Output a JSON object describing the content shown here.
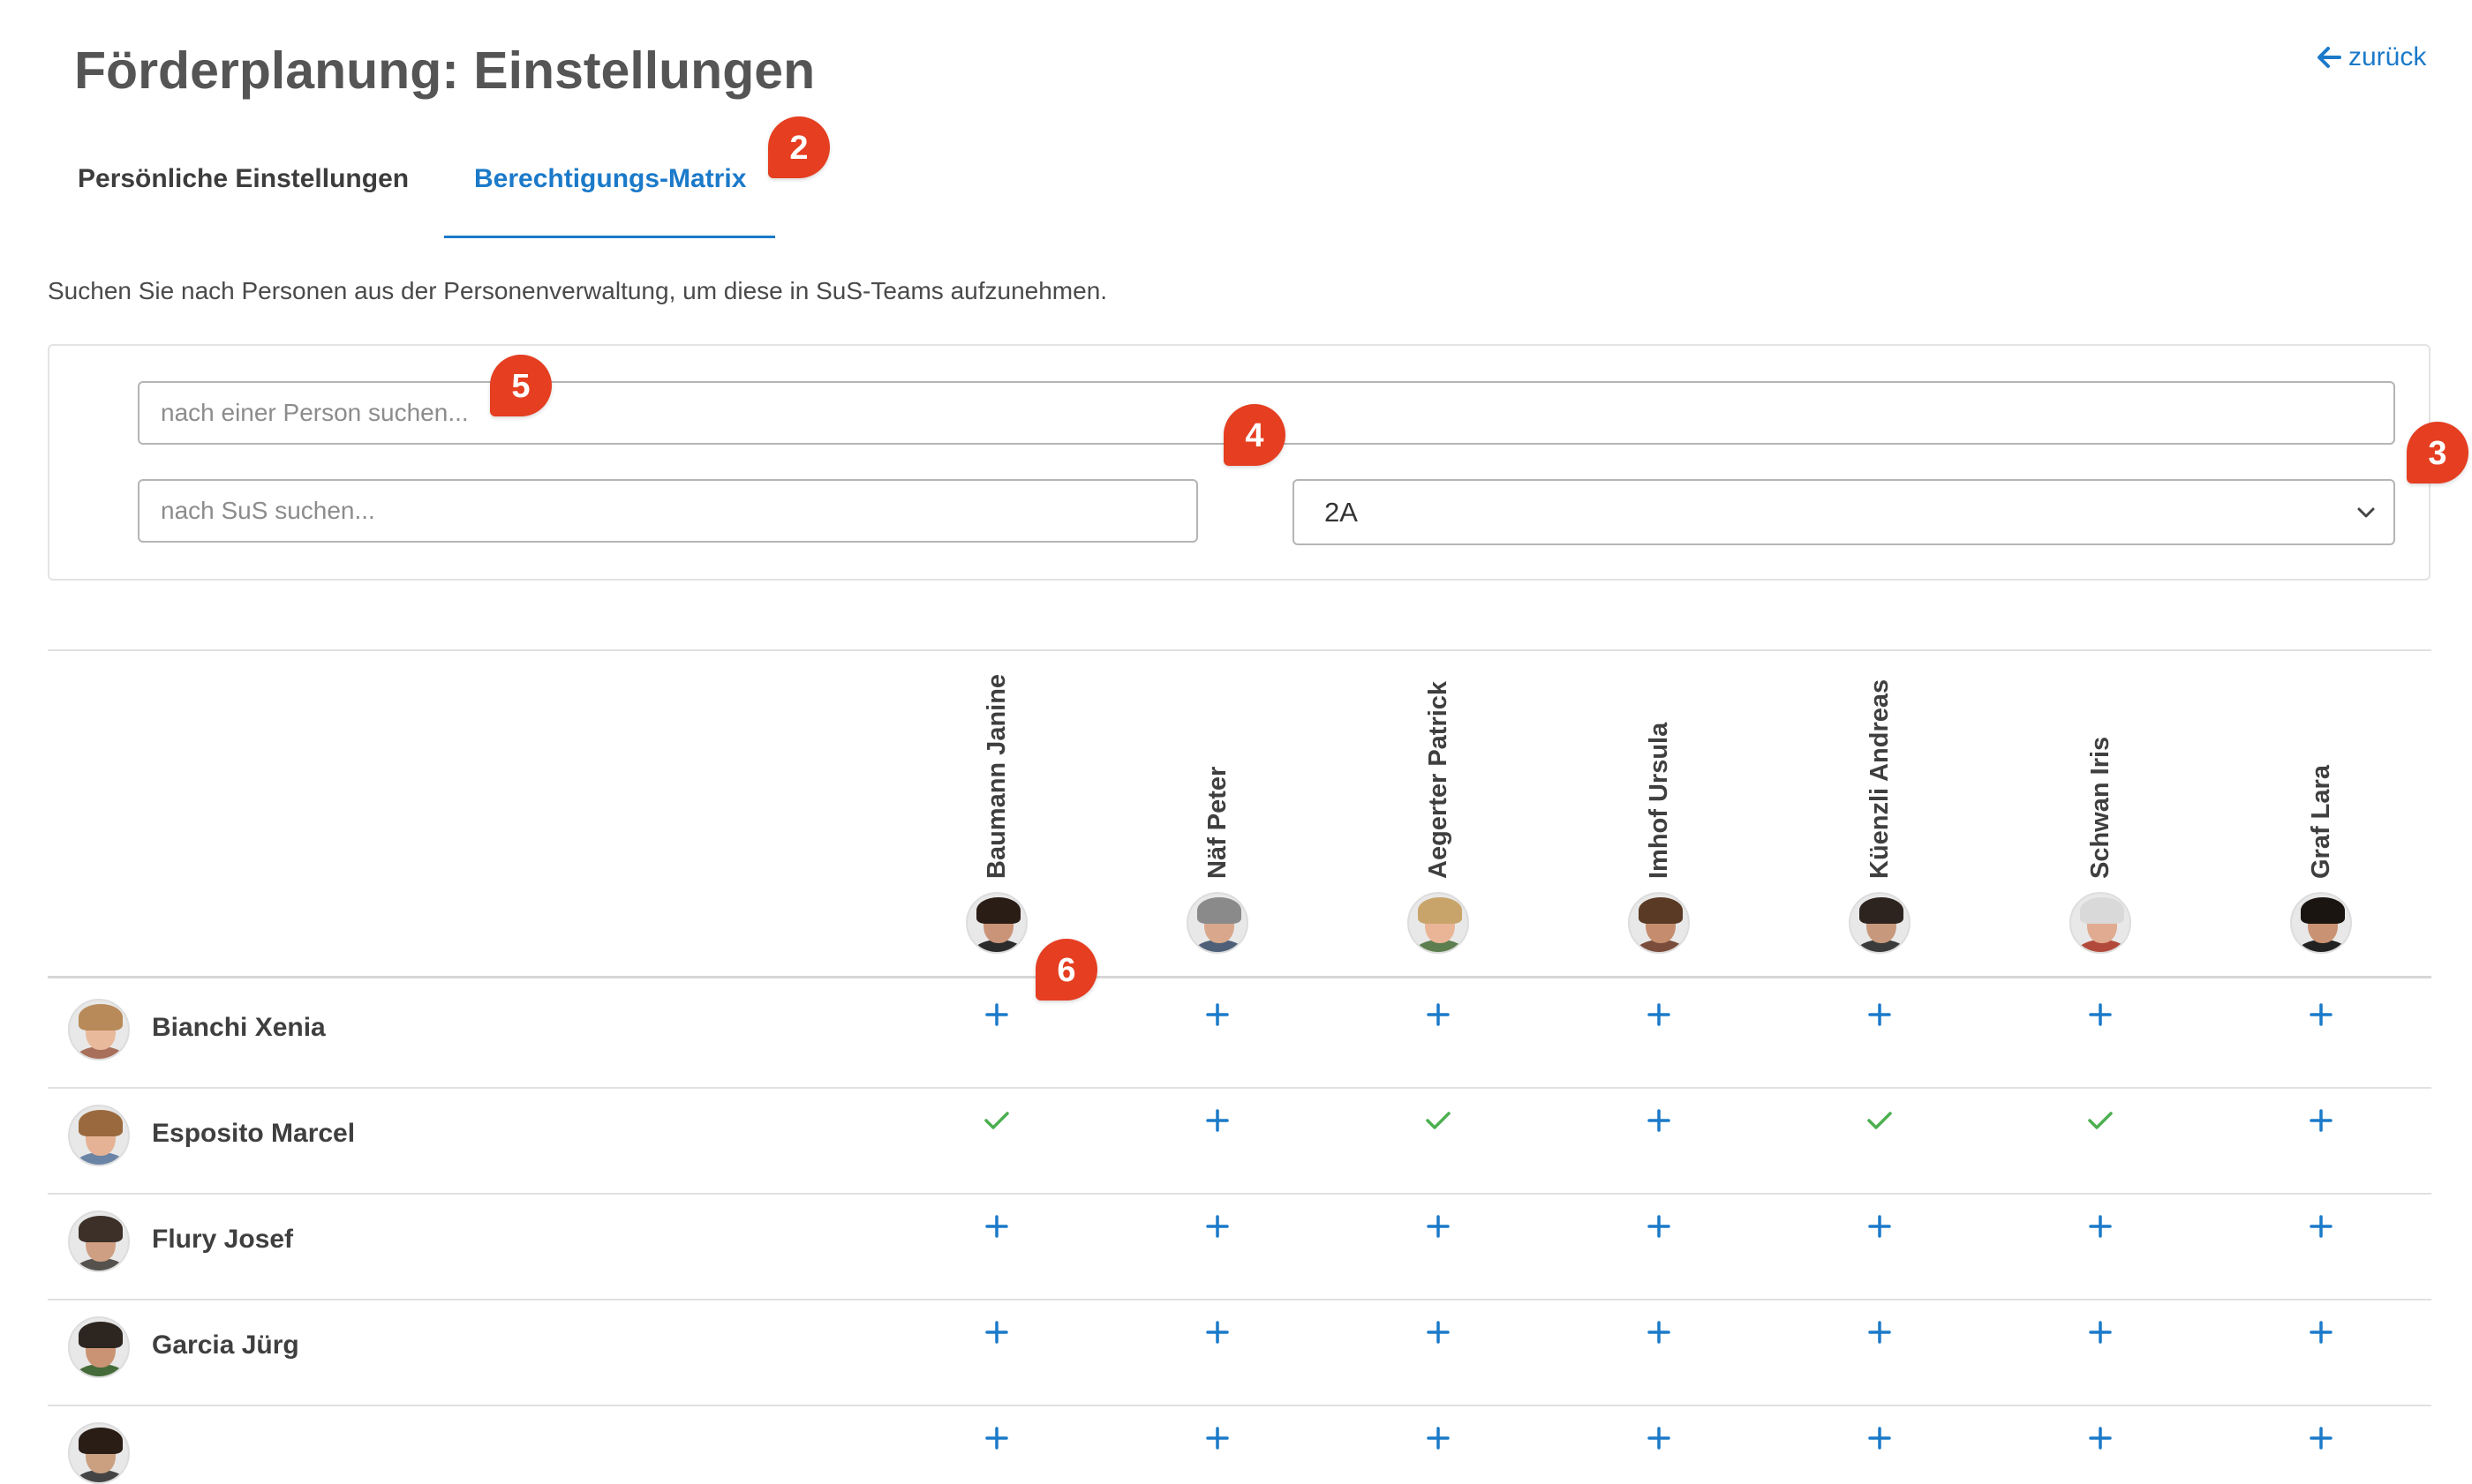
{
  "header": {
    "title": "Förderplanung: Einstellungen",
    "back_label": "zurück"
  },
  "tabs": [
    {
      "label": "Persönliche Einstellungen",
      "active": false
    },
    {
      "label": "Berechtigungs-Matrix",
      "active": true
    }
  ],
  "description": "Suchen Sie nach Personen aus der Personenverwaltung, um diese in SuS-Teams aufzunehmen.",
  "search": {
    "person_placeholder": "nach einer Person suchen...",
    "person_value": "",
    "sus_placeholder": "nach SuS suchen...",
    "sus_value": "",
    "class_selected": "2A"
  },
  "columns": [
    {
      "name": "Baumann Janine"
    },
    {
      "name": "Näf Peter"
    },
    {
      "name": "Aegerter Patrick"
    },
    {
      "name": "Imhof Ursula"
    },
    {
      "name": "Küenzli Andreas"
    },
    {
      "name": "Schwan Iris"
    },
    {
      "name": "Graf Lara"
    }
  ],
  "rows": [
    {
      "name": "Bianchi Xenia",
      "cells": [
        "add",
        "add",
        "add",
        "add",
        "add",
        "add",
        "add"
      ]
    },
    {
      "name": "Esposito Marcel",
      "cells": [
        "check",
        "add",
        "check",
        "add",
        "check",
        "check",
        "add"
      ]
    },
    {
      "name": "Flury Josef",
      "cells": [
        "add",
        "add",
        "add",
        "add",
        "add",
        "add",
        "add"
      ]
    },
    {
      "name": "Garcia Jürg",
      "cells": [
        "add",
        "add",
        "add",
        "add",
        "add",
        "add",
        "add"
      ]
    }
  ],
  "markers": [
    "2",
    "3",
    "4",
    "5",
    "6"
  ],
  "colors": {
    "accent": "#1b7ac9",
    "check": "#4caf50",
    "marker": "#e53e21"
  },
  "icons": {
    "back": "arrow-left-icon",
    "select": "chevron-down-icon",
    "add": "plus-icon",
    "assigned": "checkmark-icon"
  }
}
